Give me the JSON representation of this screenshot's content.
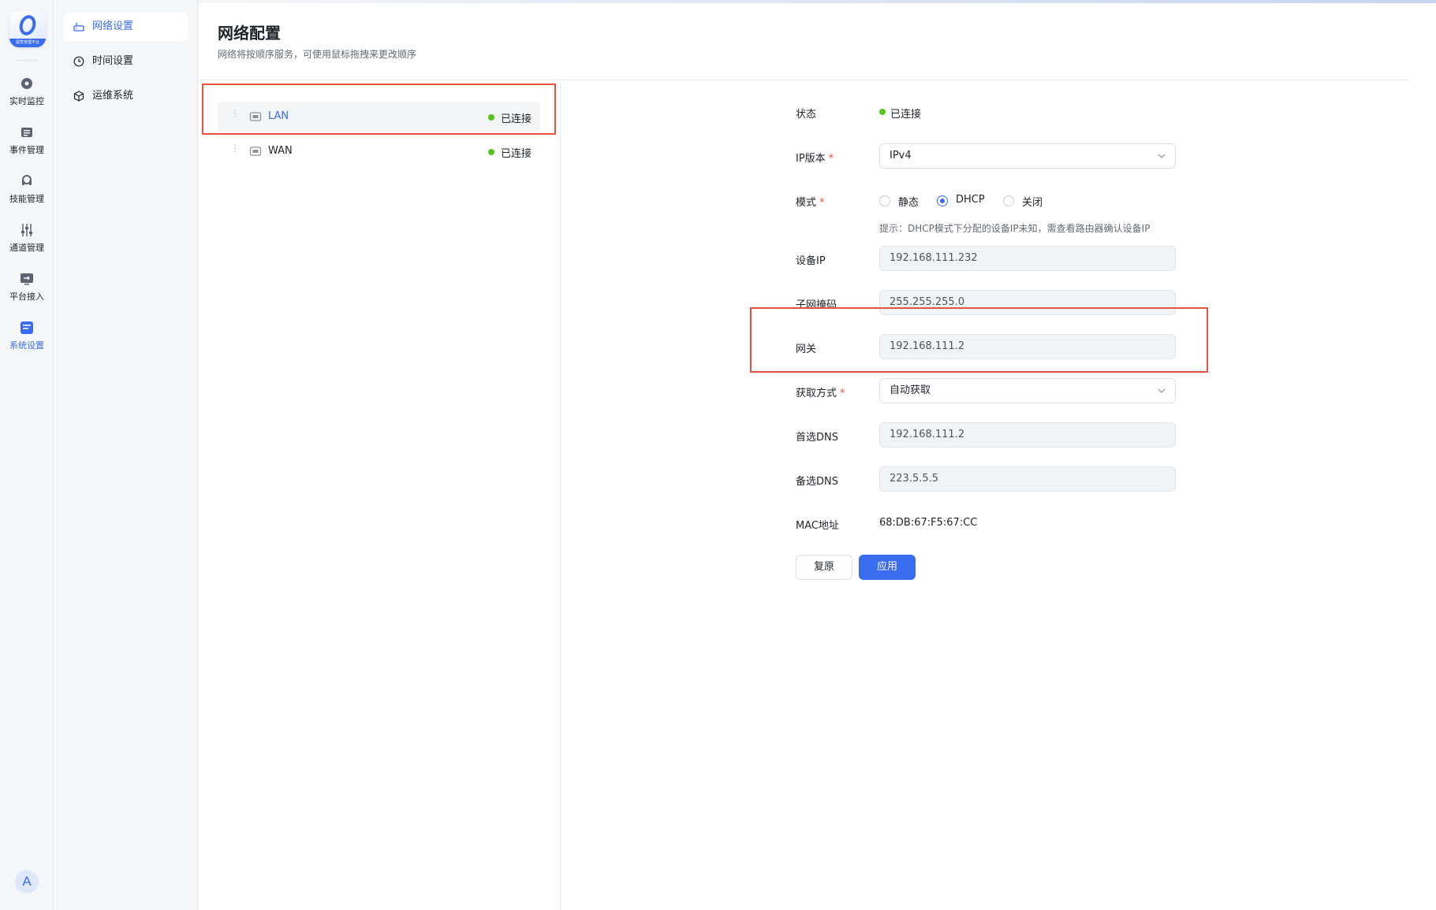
{
  "rail": {
    "logo_text": "视觉管理平台",
    "items": [
      {
        "label": "实时监控",
        "icon": "monitor-icon"
      },
      {
        "label": "事件管理",
        "icon": "event-icon"
      },
      {
        "label": "技能管理",
        "icon": "skill-icon"
      },
      {
        "label": "通道管理",
        "icon": "channel-icon"
      },
      {
        "label": "平台接入",
        "icon": "platform-icon"
      },
      {
        "label": "系统设置",
        "icon": "system-settings-icon",
        "active": true
      }
    ],
    "avatar": "A"
  },
  "submenu": {
    "items": [
      {
        "label": "网络设置",
        "icon": "network-icon",
        "active": true
      },
      {
        "label": "时间设置",
        "icon": "clock-icon"
      },
      {
        "label": "运维系统",
        "icon": "ops-icon"
      }
    ]
  },
  "page": {
    "title": "网络配置",
    "subtitle": "网络将按顺序服务，可使用鼠标拖拽来更改顺序"
  },
  "networks": [
    {
      "name": "LAN",
      "status": "已连接",
      "selected": true
    },
    {
      "name": "WAN",
      "status": "已连接",
      "selected": false
    }
  ],
  "form": {
    "status_label": "状态",
    "status_value": "已连接",
    "ip_version_label": "IP版本",
    "ip_version_value": "IPv4",
    "mode_label": "模式",
    "mode_options": [
      "静态",
      "DHCP",
      "关闭"
    ],
    "mode_selected": "DHCP",
    "hint": "提示：DHCP模式下分配的设备IP未知，需查看路由器确认设备IP",
    "device_ip_label": "设备IP",
    "device_ip_value": "192.168.111.232",
    "subnet_label": "子网掩码",
    "subnet_value": "255.255.255.0",
    "gateway_label": "网关",
    "gateway_value": "192.168.111.2",
    "acquire_label": "获取方式",
    "acquire_value": "自动获取",
    "dns1_label": "首选DNS",
    "dns1_value": "192.168.111.2",
    "dns2_label": "备选DNS",
    "dns2_value": "223.5.5.5",
    "mac_label": "MAC地址",
    "mac_value": "68:DB:67:F5:67:CC",
    "reset_label": "复原",
    "apply_label": "应用"
  },
  "colors": {
    "accent": "#3a6cf0",
    "connected": "#52c41a",
    "required": "#f54a45",
    "annotation": "#e5533c"
  }
}
